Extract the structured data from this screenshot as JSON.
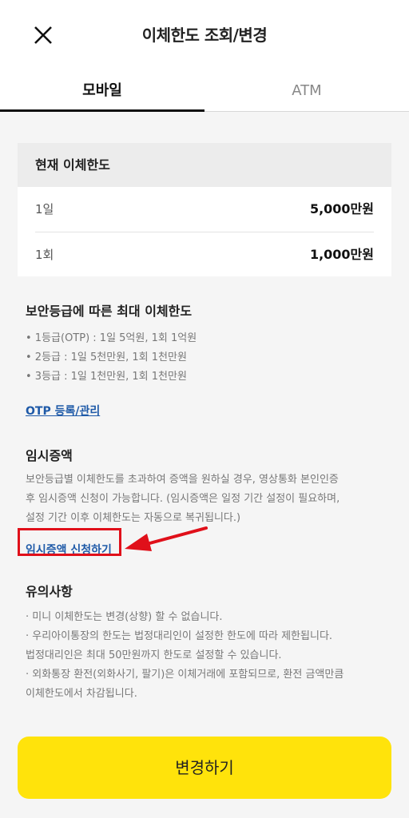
{
  "header": {
    "title": "이체한도 조회/변경",
    "close_icon": "close-icon"
  },
  "tabs": [
    {
      "label": "모바일",
      "active": true
    },
    {
      "label": "ATM",
      "active": false
    }
  ],
  "current_limit": {
    "heading": "현재 이체한도",
    "rows": [
      {
        "label": "1일",
        "value": "5,000만원"
      },
      {
        "label": "1회",
        "value": "1,000만원"
      }
    ]
  },
  "security": {
    "title": "보안등급에 따른 최대 이체한도",
    "items": [
      "• 1등급(OTP) : 1일 5억원, 1회 1억원",
      "• 2등급 : 1일 5천만원, 1회 1천만원",
      "• 3등급 : 1일 1천만원, 1회 1천만원"
    ],
    "otp_link": "OTP 등록/관리"
  },
  "temporary": {
    "title": "임시증액",
    "lines": [
      "보안등급별 이체한도를 초과하여 증액을 원하실 경우, 영상통화 본인인증",
      "후 임시증액 신청이 가능합니다. (임시증액은 일정 기간 설정이 필요하며,",
      "설정 기간 이후 이체한도는 자동으로 복귀됩니다.)"
    ],
    "apply_link": "임시증액 신청하기"
  },
  "notice": {
    "title": "유의사항",
    "lines": [
      "· 미니 이체한도는 변경(상향) 할 수 없습니다.",
      "· 우리아이통장의 한도는 법정대리인이 설정한 한도에 따라 제한됩니다.",
      "법정대리인은 최대 50만원까지 한도로 설정할 수 있습니다.",
      "· 외화통장 환전(외화사기, 팔기)은 이체거래에 포함되므로, 환전 금액만큼",
      "이체한도에서 차감됩니다."
    ]
  },
  "cta": {
    "label": "변경하기"
  },
  "colors": {
    "accent": "#ffe30b",
    "link": "#1f5aa8",
    "highlight": "#e0101a"
  }
}
